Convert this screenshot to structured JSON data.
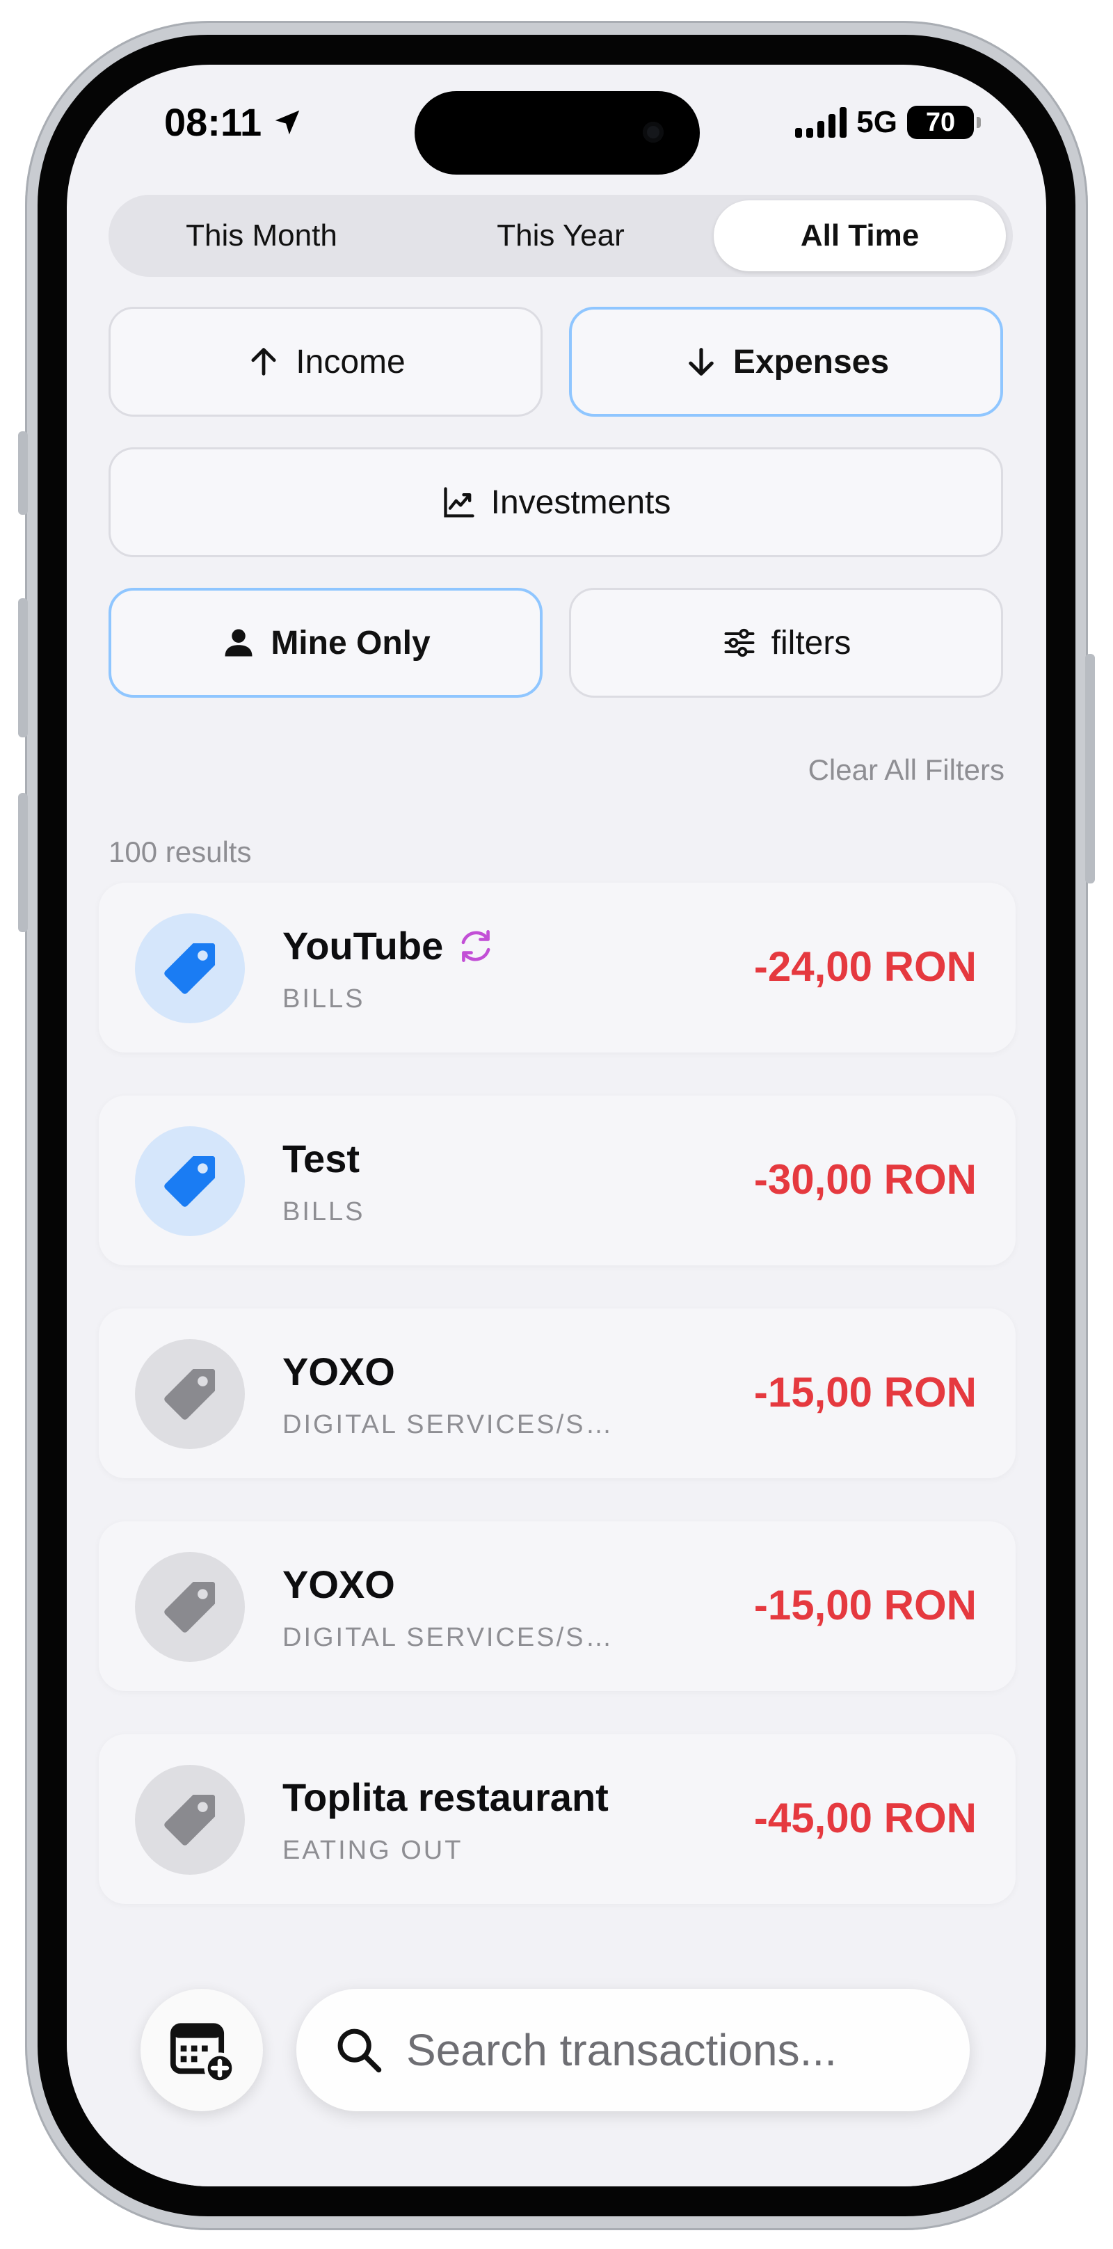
{
  "status_bar": {
    "time": "08:11",
    "network": "5G",
    "battery": "70"
  },
  "period_tabs": [
    {
      "label": "This Month",
      "active": false
    },
    {
      "label": "This Year",
      "active": false
    },
    {
      "label": "All Time",
      "active": true
    }
  ],
  "type_filters": {
    "income": {
      "label": "Income",
      "icon": "arrow-up-icon",
      "selected": false
    },
    "expenses": {
      "label": "Expenses",
      "icon": "arrow-down-icon",
      "selected": true
    },
    "investments": {
      "label": "Investments",
      "icon": "chart-line-icon",
      "selected": false
    }
  },
  "owner_filter": {
    "label": "Mine Only",
    "icon": "person-icon",
    "selected": true
  },
  "filters_button": {
    "label": "filters",
    "icon": "sliders-icon"
  },
  "clear_filters": "Clear All Filters",
  "results_count": "100 results",
  "transactions": [
    {
      "name": "YouTube",
      "category": "BILLS",
      "amount": "-24,00 RON",
      "icon_style": "blue",
      "recurring": true
    },
    {
      "name": "Test",
      "category": "BILLS",
      "amount": "-30,00 RON",
      "icon_style": "blue",
      "recurring": false
    },
    {
      "name": "YOXO",
      "category": "DIGITAL SERVICES/SUBS…",
      "amount": "-15,00 RON",
      "icon_style": "gray",
      "recurring": false
    },
    {
      "name": "YOXO",
      "category": "DIGITAL SERVICES/SUBS…",
      "amount": "-15,00 RON",
      "icon_style": "gray",
      "recurring": false
    },
    {
      "name": "Toplita restaurant",
      "category": "EATING OUT",
      "amount": "-45,00 RON",
      "icon_style": "gray",
      "recurring": false
    }
  ],
  "search": {
    "placeholder": "Search transactions..."
  },
  "colors": {
    "accent_border": "#8fc6ff",
    "expense_red": "#e5393f",
    "tag_blue": "#1a7cf3",
    "tag_gray": "#8a8a8f",
    "recurring_purple": "#c24fd6"
  }
}
